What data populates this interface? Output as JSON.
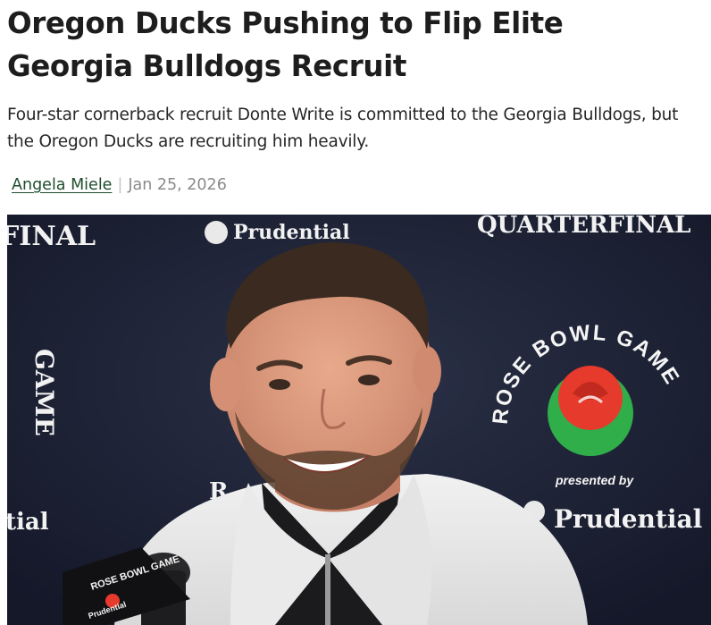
{
  "article": {
    "headline": "Oregon Ducks Pushing to Flip Elite Georgia Bulldogs Recruit",
    "dek": "Four-star cornerback recruit Donte Write is committed to the Georgia Bulldogs, but the Oregon Ducks are recruiting him heavily.",
    "author": "Angela Miele",
    "separator": "|",
    "date": "Jan 25, 2026"
  },
  "image": {
    "backdrop": {
      "top_left": "FINAL",
      "top_center": "Prudential",
      "top_right": "QUARTERFINAL",
      "left_vertical": "GAME",
      "left_bottom": "tial",
      "center_partial": "R",
      "logo_text": "ROSE BOWL GAME",
      "presented_by": "presented by",
      "sponsor": "Prudential"
    },
    "mic_flag": {
      "logo_text": "ROSE BOWL GAME",
      "sponsor": "Prudential"
    }
  },
  "colors": {
    "author_link": "#1e4d2b",
    "backdrop": "#171c2e",
    "rose_red": "#e63a2c",
    "rose_green": "#2fae4a"
  }
}
